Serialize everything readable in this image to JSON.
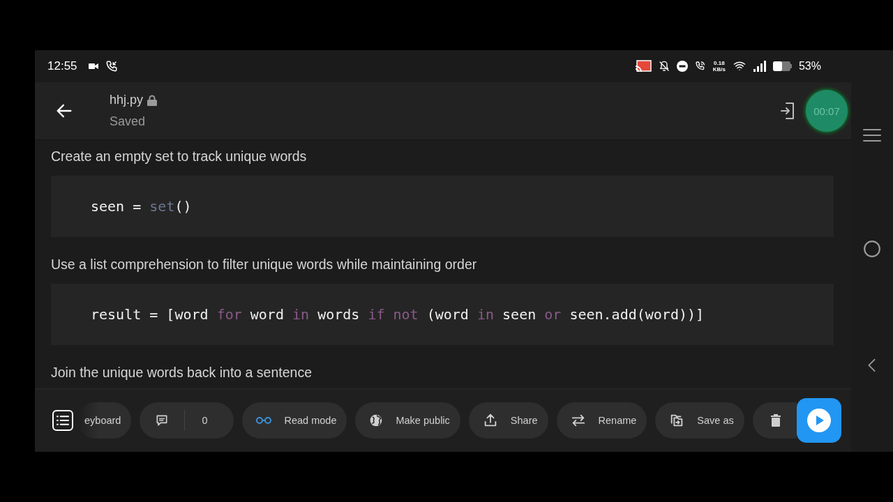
{
  "status_bar": {
    "time": "12:55",
    "speed_value": "0.18",
    "speed_unit": "KB/s",
    "battery": "53%"
  },
  "header": {
    "filename": "hhj.py",
    "status": "Saved",
    "timer": "00:07"
  },
  "content": [
    {
      "kind": "text",
      "text": "Create an empty set to track unique words"
    },
    {
      "kind": "code",
      "tokens": [
        {
          "kind": "plain",
          "text": "seen = "
        },
        {
          "kind": "builtin",
          "text": "set"
        },
        {
          "kind": "plain",
          "text": "()"
        }
      ]
    },
    {
      "kind": "text",
      "text": "Use a list comprehension to filter unique words while maintaining order"
    },
    {
      "kind": "code",
      "tokens": [
        {
          "kind": "plain",
          "text": "result = [word "
        },
        {
          "kind": "keyword",
          "text": "for"
        },
        {
          "kind": "plain",
          "text": " word "
        },
        {
          "kind": "keyword",
          "text": "in"
        },
        {
          "kind": "plain",
          "text": " words "
        },
        {
          "kind": "keyword",
          "text": "if not"
        },
        {
          "kind": "plain",
          "text": " (word "
        },
        {
          "kind": "keyword",
          "text": "in"
        },
        {
          "kind": "plain",
          "text": " seen "
        },
        {
          "kind": "keyword",
          "text": "or"
        },
        {
          "kind": "plain",
          "text": " seen.add(word))]"
        }
      ]
    },
    {
      "kind": "text",
      "text": "Join the unique words back into a sentence"
    }
  ],
  "toolbar": {
    "chips": [
      {
        "kind": "keyboard",
        "label": "eyboard"
      },
      {
        "kind": "comments",
        "count": "0"
      },
      {
        "kind": "read",
        "label": "Read mode"
      },
      {
        "kind": "public",
        "label": "Make public"
      },
      {
        "kind": "share",
        "label": "Share"
      },
      {
        "kind": "rename",
        "label": "Rename"
      },
      {
        "kind": "save",
        "label": "Save as"
      },
      {
        "kind": "delete"
      }
    ]
  }
}
